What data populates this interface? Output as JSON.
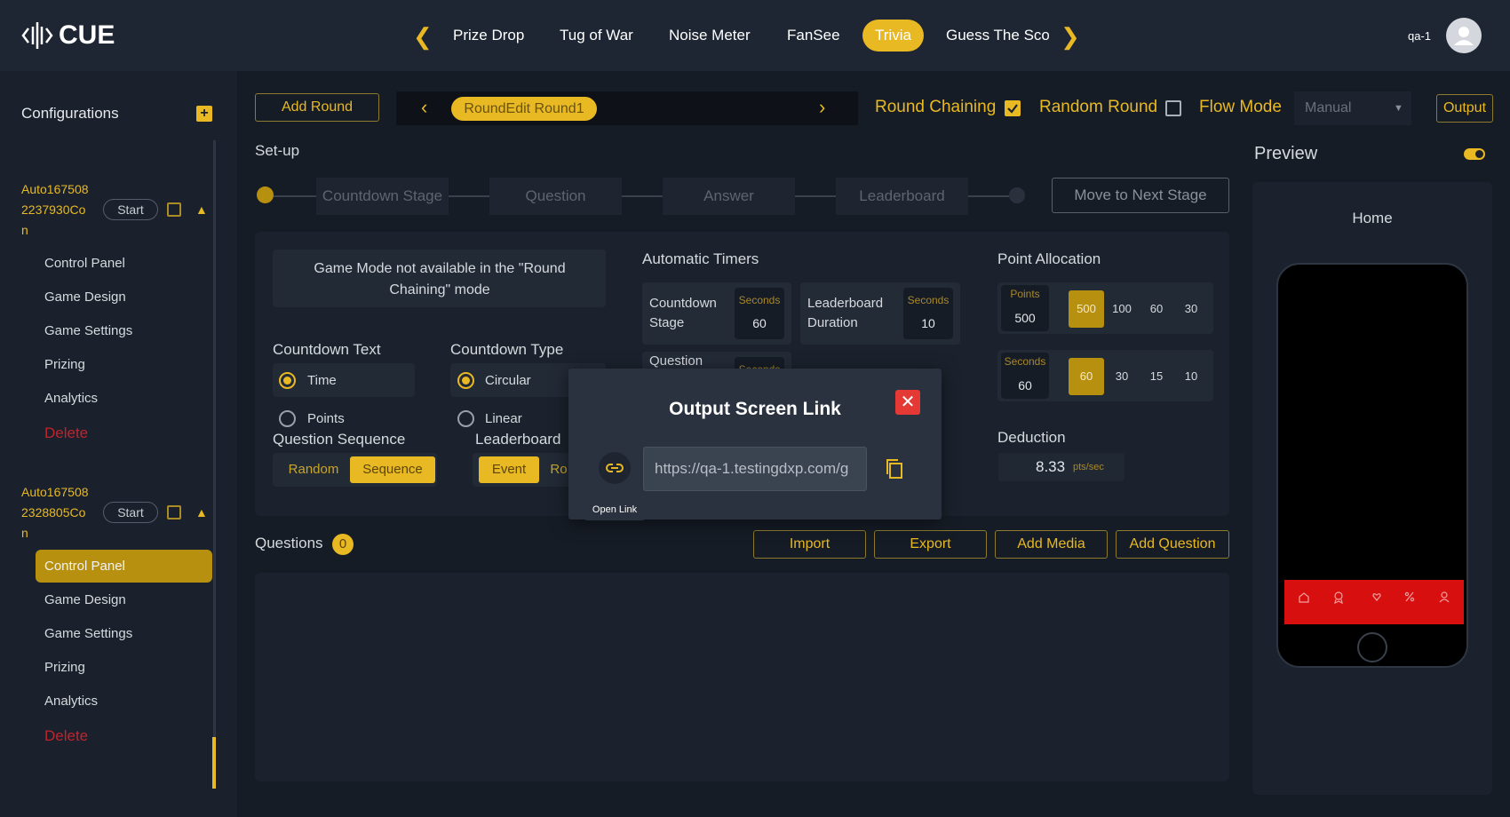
{
  "brand": {
    "name": "CUE"
  },
  "nav": {
    "tabs": [
      "Prize Drop",
      "Tug of War",
      "Noise Meter",
      "FanSee",
      "Trivia",
      "Guess The Sco"
    ],
    "active": "Trivia",
    "user": "qa-1"
  },
  "sidebar": {
    "title": "Configurations",
    "configs": [
      {
        "name_lines": [
          "Auto167508",
          "2237930Co",
          "n"
        ],
        "start": "Start",
        "items": [
          "Control Panel",
          "Game Design",
          "Game Settings",
          "Prizing",
          "Analytics"
        ],
        "delete": "Delete"
      },
      {
        "name_lines": [
          "Auto167508",
          "2328805Co",
          "n"
        ],
        "start": "Start",
        "items": [
          "Control Panel",
          "Game Design",
          "Game Settings",
          "Prizing",
          "Analytics"
        ],
        "delete": "Delete"
      }
    ]
  },
  "toolbar": {
    "add_round": "Add Round",
    "round_name": "RoundEdit Round1",
    "round_chaining": "Round Chaining",
    "random_round": "Random Round",
    "flow_mode": "Flow Mode",
    "flow_mode_value": "Manual",
    "output": "Output"
  },
  "setup": {
    "title": "Set-up",
    "stages": [
      "Countdown Stage",
      "Question",
      "Answer",
      "Leaderboard"
    ],
    "next_stage": "Move to Next Stage"
  },
  "config_panel": {
    "game_mode_note": "Game Mode not available in the \"Round Chaining\" mode",
    "countdown_text": {
      "title": "Countdown Text",
      "options": [
        "Time",
        "Points"
      ],
      "selected": "Time"
    },
    "countdown_type": {
      "title": "Countdown Type",
      "options": [
        "Circular",
        "Linear"
      ],
      "selected": "Circular"
    },
    "question_sequence": {
      "title": "Question Sequence",
      "options": [
        "Random",
        "Sequence"
      ],
      "selected": "Sequence"
    },
    "leaderboard": {
      "title": "Leaderboard",
      "options": [
        "Event",
        "Ro"
      ],
      "selected": "Event"
    },
    "timers": {
      "title": "Automatic Timers",
      "items": [
        {
          "label_lines": [
            "Countdown",
            "Stage"
          ],
          "unit": "Seconds",
          "value": "60"
        },
        {
          "label_lines": [
            "Leaderboard",
            "Duration"
          ],
          "unit": "Seconds",
          "value": "10"
        },
        {
          "label_lines": [
            "Question"
          ],
          "unit": "Seconds",
          "value": ""
        }
      ]
    },
    "points": {
      "title": "Point Allocation",
      "points_label": "Points",
      "points_value": "500",
      "points_options": [
        "500",
        "100",
        "60",
        "30"
      ],
      "points_selected": "500",
      "seconds_label": "Seconds",
      "seconds_value": "60",
      "seconds_options": [
        "60",
        "30",
        "15",
        "10"
      ],
      "seconds_selected": "60"
    },
    "deduction": {
      "title": "Deduction",
      "value": "8.33",
      "unit": "pts/sec"
    }
  },
  "questions": {
    "title": "Questions",
    "count": "0",
    "buttons": [
      "Import",
      "Export",
      "Add Media",
      "Add Question"
    ]
  },
  "preview": {
    "title": "Preview",
    "screen_title": "Home"
  },
  "modal": {
    "title": "Output Screen Link",
    "url": "https://qa-1.testingdxp.com/g",
    "tooltip": "Open Link"
  },
  "colors": {
    "accent": "#e8b923",
    "danger": "#e53935",
    "phone_bar": "#d80f0f"
  }
}
